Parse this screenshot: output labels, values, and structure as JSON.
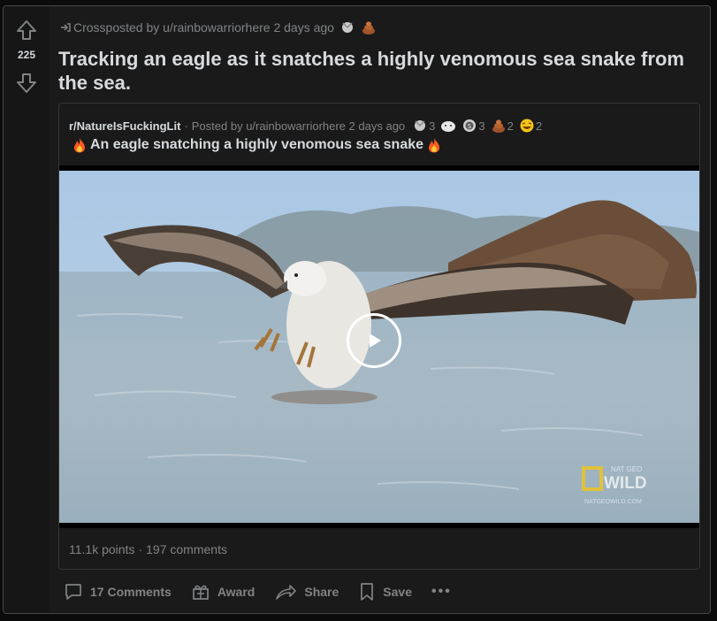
{
  "vote": {
    "score": "225"
  },
  "crosspost": {
    "prefix": "Crossposted by",
    "user": "u/rainbowarriorhere",
    "time": "2 days ago"
  },
  "post": {
    "title": "Tracking an eagle as it snatches a highly venomous sea snake from the sea."
  },
  "original": {
    "subreddit": "r/NatureIsFuckingLit",
    "separator": "·",
    "posted_by": "Posted by u/rainbowarriorhere",
    "time": "2 days ago",
    "awards": [
      {
        "icon": "silver-award-icon",
        "count": "3"
      },
      {
        "icon": "wholesome-seal-award-icon",
        "count": ""
      },
      {
        "icon": "helpful-award-icon",
        "count": "3"
      },
      {
        "icon": "poop-award-icon",
        "count": "2"
      },
      {
        "icon": "laughing-award-icon",
        "count": "2"
      }
    ],
    "title": "An eagle snatching a highly venomous sea snake",
    "title_icon": "fire-icon",
    "video": {
      "watermark_top": "NAT GEO",
      "watermark_main": "WILD",
      "watermark_url": "NATGEOWILD.COM"
    },
    "points": "11.1k points",
    "dot": "·",
    "comments": "197 comments"
  },
  "actions": {
    "comments": "17 Comments",
    "award": "Award",
    "share": "Share",
    "save": "Save",
    "more": "•••"
  },
  "colors": {
    "background": "#1a1a1b",
    "text": "#d7dadc",
    "muted": "#818384",
    "border": "#474748"
  }
}
